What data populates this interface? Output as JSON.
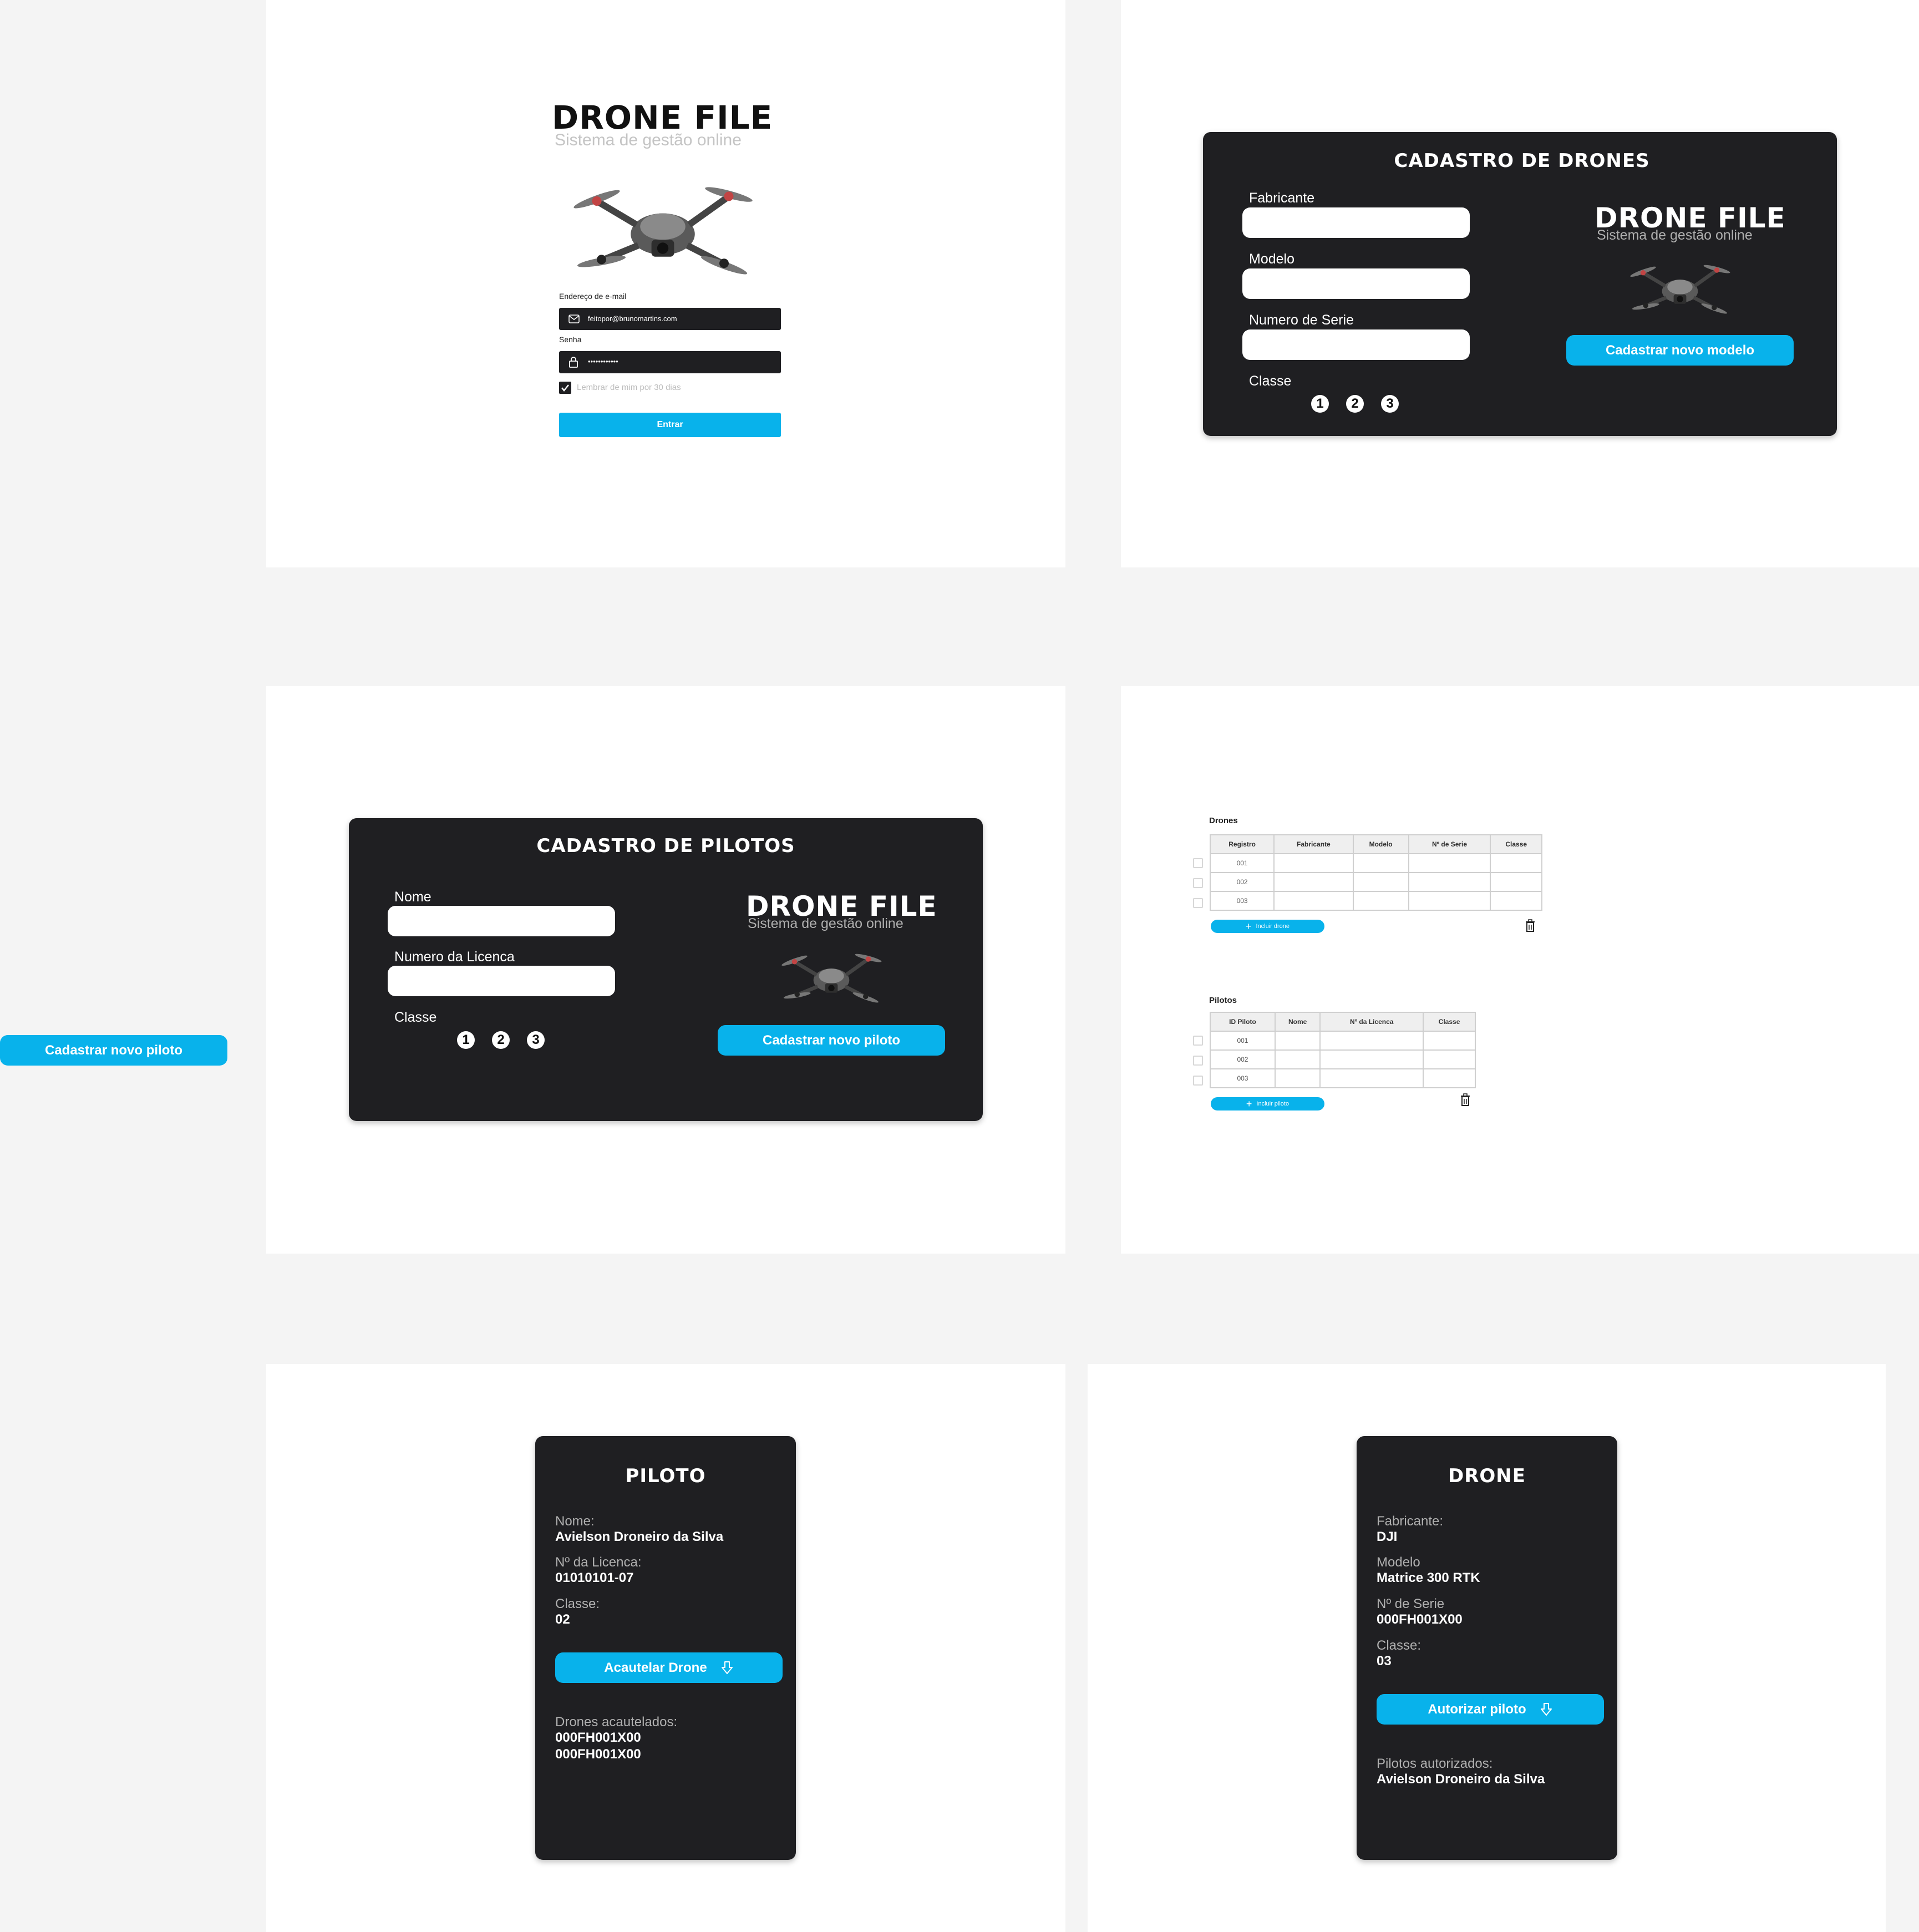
{
  "brand": {
    "name": "DRONE FILE",
    "tagline": "Sistema de gestão online"
  },
  "login": {
    "email_label": "Endereço de e-mail",
    "email_value": "feitopor@brunomartins.com",
    "password_label": "Senha",
    "password_value": "••••••••••••",
    "remember_label": "Lembrar de mim por 30 dias",
    "submit_label": "Entrar"
  },
  "drone_form": {
    "title": "CADASTRO DE DRONES",
    "fabricante_label": "Fabricante",
    "modelo_label": "Modelo",
    "serie_label": "Numero de Serie",
    "classe_label": "Classe",
    "classes": [
      "1",
      "2",
      "3"
    ],
    "submit_label": "Cadastrar novo modelo"
  },
  "pilot_form": {
    "title": "CADASTRO DE PILOTOS",
    "nome_label": "Nome",
    "licenca_label": "Numero da Licenca",
    "classe_label": "Classe",
    "classes": [
      "1",
      "2",
      "3"
    ],
    "submit_label": "Cadastrar novo piloto"
  },
  "floating_button": {
    "label": "Cadastrar novo piloto"
  },
  "drones_table": {
    "title": "Drones",
    "headers": [
      "Registro",
      "Fabricante",
      "Modelo",
      "Nº de Serie",
      "Classe"
    ],
    "rows": [
      [
        "001",
        "",
        "",
        "",
        ""
      ],
      [
        "002",
        "",
        "",
        "",
        ""
      ],
      [
        "003",
        "",
        "",
        "",
        ""
      ]
    ],
    "add_label": "Incluir drone"
  },
  "pilots_table": {
    "title": "Pilotos",
    "headers": [
      "ID Piloto",
      "Nome",
      "Nº da Licenca",
      "Classe"
    ],
    "rows": [
      [
        "001",
        "",
        "",
        ""
      ],
      [
        "002",
        "",
        "",
        ""
      ],
      [
        "003",
        "",
        "",
        ""
      ]
    ],
    "add_label": "Incluir piloto"
  },
  "pilot_card": {
    "title": "PILOTO",
    "nome_label": "Nome:",
    "nome_value": "Avielson Droneiro da Silva",
    "licenca_label": "Nº da Licenca:",
    "licenca_value": "01010101-07",
    "classe_label": "Classe:",
    "classe_value": "02",
    "action_label": "Acautelar Drone",
    "list_label": "Drones acautelados:",
    "list": [
      "000FH001X00",
      "000FH001X00"
    ]
  },
  "drone_card": {
    "title": "DRONE",
    "fabricante_label": "Fabricante:",
    "fabricante_value": "DJI",
    "modelo_label": "Modelo",
    "modelo_value": "Matrice 300 RTK",
    "serie_label": "Nº de Serie",
    "serie_value": "000FH001X00",
    "classe_label": "Classe:",
    "classe_value": "03",
    "action_label": "Autorizar piloto",
    "list_label": "Pilotos autorizados:",
    "list": [
      "Avielson Droneiro da Silva"
    ]
  },
  "colors": {
    "accent": "#08b2eb",
    "dark_panel": "#1f1f22",
    "frame": "#ffffff",
    "canvas": "#f4f4f4"
  },
  "icons": [
    "mail-icon",
    "lock-icon",
    "check-icon",
    "plus-icon",
    "trash-icon",
    "download-arrow-icon",
    "drone-icon"
  ]
}
